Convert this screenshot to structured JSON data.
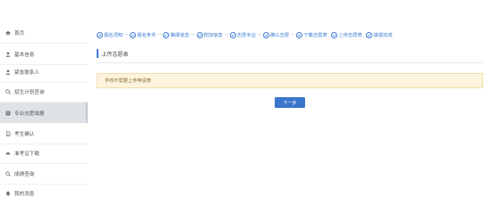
{
  "sidebar": {
    "items": [
      {
        "label": "首页",
        "icon": "home-icon"
      },
      {
        "label": "基本信息",
        "icon": "user-icon"
      },
      {
        "label": "紧急联系人",
        "icon": "user-icon"
      },
      {
        "label": "招生计划查询",
        "icon": "search-icon"
      },
      {
        "label": "专业志愿填报",
        "icon": "form-icon",
        "active": true
      },
      {
        "label": "考生确认",
        "icon": "document-icon"
      },
      {
        "label": "准考证下载",
        "icon": "cloud-download-icon"
      },
      {
        "label": "成绩查询",
        "icon": "search-icon"
      },
      {
        "label": "我的消息",
        "icon": "bell-icon"
      }
    ]
  },
  "steps": [
    {
      "label": "报名须知"
    },
    {
      "label": "报名条件"
    },
    {
      "label": "确报信息"
    },
    {
      "label": "附加信息"
    },
    {
      "label": "志愿专业"
    },
    {
      "label": "确认志愿"
    },
    {
      "label": "下载志愿表"
    },
    {
      "label": "上传志愿表"
    },
    {
      "label": "填报完成"
    }
  ],
  "main": {
    "section_title": "上传志愿表",
    "notice_text": "学校不需要上传申请表",
    "next_button": "下一步"
  },
  "colors": {
    "accent": "#3a75cc",
    "notice_bg": "#fcf4dd",
    "active_sidebar_bg": "#dfe3e8"
  }
}
